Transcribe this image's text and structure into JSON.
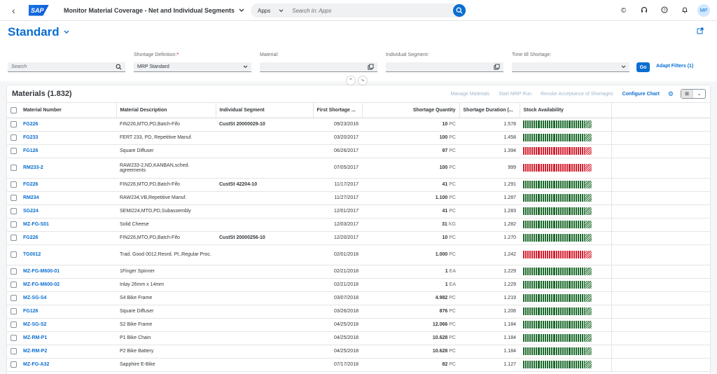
{
  "shell": {
    "app_title": "Monitor Material Coverage - Net and Individual Segments",
    "search_scope": "Apps",
    "search_placeholder": "Search in: Apps",
    "avatar": "MP"
  },
  "header": {
    "variant": "Standard"
  },
  "filterbar": {
    "search_placeholder": "Search",
    "shortage_label": "Shortage Definition:",
    "shortage_required": "*",
    "shortage_value": "MRP Standard",
    "material_label": "Material:",
    "segment_label": "Individual Segment:",
    "time_label": "Time till Shortage:",
    "go_label": "Go",
    "adapt_label": "Adapt Filters (1)"
  },
  "table": {
    "title": "Materials (1.832)",
    "actions": {
      "manage": "Manage Materials",
      "mrp": "Start MRP Run",
      "revoke": "Revoke Acceptance of Shortages",
      "configure": "Configure Chart"
    },
    "columns": [
      "Material Number",
      "Material Description",
      "Individual Segment",
      "First Shortage ...",
      "Shortage Quantity",
      "Shortage Duration (...",
      "Stock Availability"
    ],
    "rows": [
      {
        "mat": "FG226",
        "desc": "FIN226,MTO,PD,Batch-Fifo",
        "seg": "CustSt 20000029-10",
        "date": "09/23/2016",
        "qty": "10",
        "unit": "PC",
        "dur": "1.578",
        "status": "green",
        "tall": false
      },
      {
        "mat": "FG233",
        "desc": "FERT 233, PD, Repetitive Manuf.",
        "seg": "",
        "date": "03/20/2017",
        "qty": "100",
        "unit": "PC",
        "dur": "1.458",
        "status": "green",
        "tall": false
      },
      {
        "mat": "FG126",
        "desc": "Square Diffuser",
        "seg": "",
        "date": "06/26/2017",
        "qty": "97",
        "unit": "PC",
        "dur": "1.394",
        "status": "red",
        "tall": false
      },
      {
        "mat": "RM233-2",
        "desc": "RAW233-2,ND,KANBAN,sched. agreements",
        "seg": "",
        "date": "07/05/2017",
        "qty": "100",
        "unit": "PC",
        "dur": "999",
        "status": "red",
        "tall": true
      },
      {
        "mat": "FG226",
        "desc": "FIN226,MTO,PD,Batch-Fifo",
        "seg": "CustSt 42204-10",
        "date": "11/17/2017",
        "qty": "41",
        "unit": "PC",
        "dur": "1.291",
        "status": "green",
        "tall": false
      },
      {
        "mat": "RM234",
        "desc": "RAW234,VB,Repetitive Manuf.",
        "seg": "",
        "date": "11/27/2017",
        "qty": "1.100",
        "unit": "PC",
        "dur": "1.287",
        "status": "green",
        "tall": false
      },
      {
        "mat": "SG224",
        "desc": "SEMI224,MTO,PD,Subassembly",
        "seg": "",
        "date": "12/01/2017",
        "qty": "41",
        "unit": "PC",
        "dur": "1.283",
        "status": "green",
        "tall": false
      },
      {
        "mat": "MZ-FG-S01",
        "desc": "Solid Cheese",
        "seg": "",
        "date": "12/03/2017",
        "qty": "31",
        "unit": "KG",
        "dur": "1.282",
        "status": "green",
        "tall": false
      },
      {
        "mat": "FG226",
        "desc": "FIN226,MTO,PD,Batch-Fifo",
        "seg": "CustSt 20000256-10",
        "date": "12/20/2017",
        "qty": "10",
        "unit": "PC",
        "dur": "1.270",
        "status": "green",
        "tall": false
      },
      {
        "mat": "TG0012",
        "desc": "Trad. Good 0012,Reord. Pt.,Regular Proc.",
        "seg": "",
        "date": "02/01/2018",
        "qty": "1.000",
        "unit": "PC",
        "dur": "1.242",
        "status": "red",
        "tall": true
      },
      {
        "mat": "MZ-FG-M600-01",
        "desc": "1Finger Spinner",
        "seg": "",
        "date": "02/21/2018",
        "qty": "1",
        "unit": "EA",
        "dur": "1.229",
        "status": "green",
        "tall": false
      },
      {
        "mat": "MZ-FG-M600-02",
        "desc": "Inlay 26mm x 14mm",
        "seg": "",
        "date": "02/21/2018",
        "qty": "1",
        "unit": "EA",
        "dur": "1.229",
        "status": "green",
        "tall": false
      },
      {
        "mat": "MZ-SG-S4",
        "desc": "S4 Bike Frame",
        "seg": "",
        "date": "03/07/2018",
        "qty": "4.982",
        "unit": "PC",
        "dur": "1.219",
        "status": "green",
        "tall": false
      },
      {
        "mat": "FG126",
        "desc": "Square Diffuser",
        "seg": "",
        "date": "03/26/2018",
        "qty": "876",
        "unit": "PC",
        "dur": "1.206",
        "status": "green",
        "tall": false
      },
      {
        "mat": "MZ-SG-S2",
        "desc": "S2 Bike Frame",
        "seg": "",
        "date": "04/25/2018",
        "qty": "12.066",
        "unit": "PC",
        "dur": "1.184",
        "status": "green",
        "tall": false
      },
      {
        "mat": "MZ-RM-P1",
        "desc": "P1 Bike Chain",
        "seg": "",
        "date": "04/25/2018",
        "qty": "10.628",
        "unit": "PC",
        "dur": "1.184",
        "status": "green",
        "tall": false
      },
      {
        "mat": "MZ-RM-P2",
        "desc": "P2 Bike Battery",
        "seg": "",
        "date": "04/25/2018",
        "qty": "10.628",
        "unit": "PC",
        "dur": "1.184",
        "status": "green",
        "tall": false
      },
      {
        "mat": "MZ-FG-A32",
        "desc": "Sapphire E-Bike",
        "seg": "",
        "date": "07/17/2018",
        "qty": "82",
        "unit": "PC",
        "dur": "1.127",
        "status": "green",
        "tall": false
      }
    ]
  },
  "colors": {
    "accent": "#0a6ed1",
    "ok": "#1e6b2e",
    "critical": "#d32030"
  }
}
